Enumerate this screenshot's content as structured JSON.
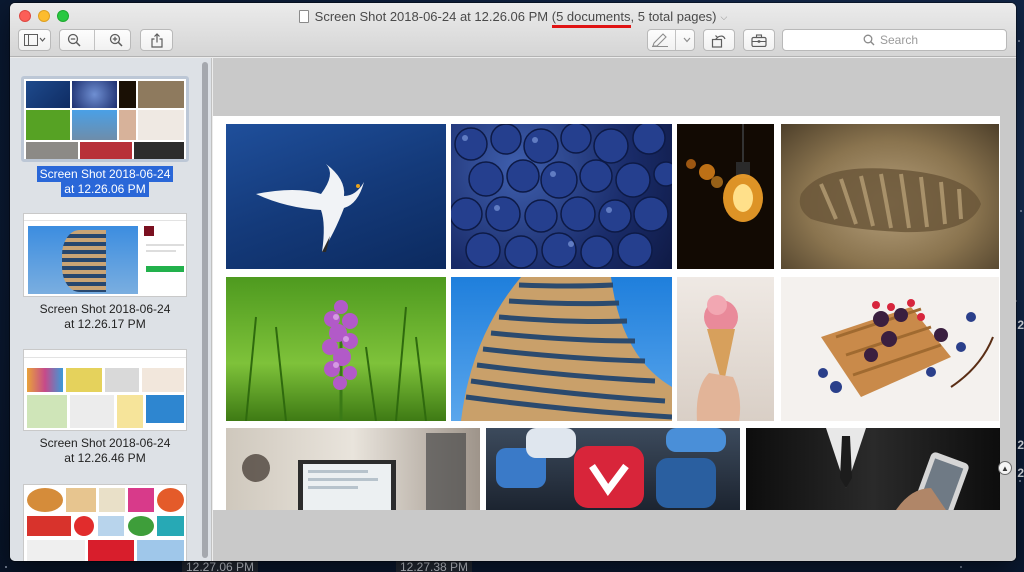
{
  "window": {
    "title_prefix": "Screen Shot 2018-06-24 at 12.26.06 PM",
    "title_highlight": "(5 documents",
    "title_suffix": ", 5 total pages)"
  },
  "toolbar": {
    "search_placeholder": "Search"
  },
  "sidebar": {
    "items": [
      {
        "label_line1": "Screen Shot 2018-06-24",
        "label_line2": "at 12.26.06 PM",
        "selected": true
      },
      {
        "label_line1": "Screen Shot 2018-06-24",
        "label_line2": "at 12.26.17 PM",
        "selected": false
      },
      {
        "label_line1": "Screen Shot 2018-06-24",
        "label_line2": "at 12.26.46 PM",
        "selected": false
      },
      {
        "label_line1": "",
        "label_line2": "",
        "selected": false
      }
    ]
  },
  "desktop": {
    "label_left": "12.27.06 PM",
    "label_right": "12.27.38 PM",
    "edge_digits": [
      "2",
      "2",
      "2"
    ]
  },
  "colors": {
    "selection": "#2a67d8",
    "annotation_underline": "#e01414"
  },
  "icons": [
    "sidebar-icon",
    "zoom-out-icon",
    "zoom-in-icon",
    "share-icon",
    "markup-pen-icon",
    "rotate-icon",
    "toolbox-icon",
    "search-icon",
    "scroll-up-icon"
  ]
}
